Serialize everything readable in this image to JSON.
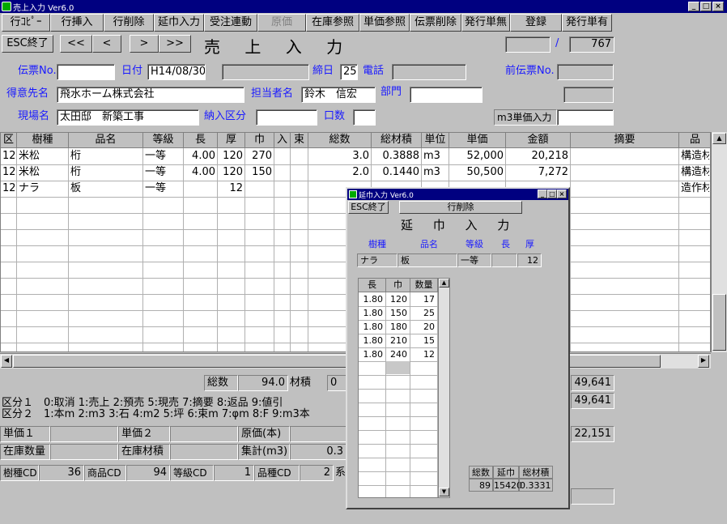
{
  "window": {
    "title": "売上入力 Ver6.0"
  },
  "toolbar": [
    {
      "label": "行ｺﾋﾟｰ",
      "disabled": false
    },
    {
      "label": "行挿入",
      "disabled": false
    },
    {
      "label": "行削除",
      "disabled": false
    },
    {
      "label": "延巾入力",
      "disabled": false
    },
    {
      "label": "受注連動",
      "disabled": false
    },
    {
      "label": "原価",
      "disabled": true
    },
    {
      "label": "在庫参照",
      "disabled": false
    },
    {
      "label": "単価参照",
      "disabled": false
    },
    {
      "label": "伝票削除",
      "disabled": false
    },
    {
      "label": "発行単無",
      "disabled": false
    },
    {
      "label": "登録",
      "disabled": false
    },
    {
      "label": "発行単有",
      "disabled": false
    }
  ],
  "nav": {
    "esc": "ESC終了",
    "first": "<<",
    "prev": "<",
    "next": ">",
    "last": ">>",
    "title": "売 上 入 力",
    "slash": "/",
    "total": "767",
    "current": ""
  },
  "form": {
    "denpyo_label": "伝票No.",
    "denpyo_value": "",
    "date_label": "日付",
    "date_value": "H14/08/30",
    "date_extra": "",
    "shime_label": "締日",
    "shime_value": "25",
    "tel_label": "電話",
    "tel_value": "",
    "prev_label": "前伝票No.",
    "prev_value": "",
    "customer_label": "得意先名",
    "customer_value": "飛水ホーム株式会社",
    "tanto_label": "担当者名",
    "tanto_value": "鈴木　信宏",
    "bumon_label": "部門",
    "bumon_value": "",
    "genba_label": "現場名",
    "genba_value": "太田邸　新築工事",
    "nonyu_label": "納入区分",
    "nonyu_value": "",
    "kuchi_label": "口数",
    "kuchi_value": "",
    "m3_label": "m3単価入力",
    "m3_value": ""
  },
  "table": {
    "columns": [
      "区",
      "樹種",
      "品名",
      "等級",
      "長",
      "厚",
      "巾",
      "入",
      "束",
      "総数",
      "総材積",
      "単位",
      "単価",
      "金額",
      "摘要",
      "品"
    ],
    "rows": [
      [
        "12",
        "米松",
        "桁",
        "一等",
        "4.00",
        "120",
        "270",
        "",
        "",
        "3.0",
        "0.3888",
        "m3",
        "52,000",
        "20,218",
        "",
        "構造材"
      ],
      [
        "12",
        "米松",
        "桁",
        "一等",
        "4.00",
        "120",
        "150",
        "",
        "",
        "2.0",
        "0.1440",
        "m3",
        "50,500",
        "7,272",
        "",
        "構造材"
      ],
      [
        "12",
        "ナラ",
        "板",
        "一等",
        "",
        "12",
        "",
        "",
        "",
        "",
        "",
        "",
        "",
        "",
        "",
        "造作材"
      ]
    ]
  },
  "bottom": {
    "sosu_label": "総数",
    "sosu_value": "94.0",
    "zaiseki_label": "材積",
    "zaiseki_value": "0",
    "amount1": "49,641",
    "amount2": "49,641",
    "amount3": "22,151",
    "kubun1": "区分１　0:取消 1:売上 2:預売 5:現売 7:摘要 8:返品 9:値引",
    "kubun2": "区分２　1:本m 2:m3 3:石 4:m2 5:坪 6:束m 7:φm 8:F 9:m3本",
    "tanka1_label": "単価１",
    "tanka1_value": "",
    "tanka2_label": "単価２",
    "tanka2_value": "",
    "genka_label": "原価(本)",
    "genka_value": "",
    "zaiko_label": "在庫数量",
    "zaiko_value": "",
    "zaikozai_label": "在庫材積",
    "zaikozai_value": "",
    "shukei_label": "集計(m3)",
    "shukei_value": "0.3",
    "jushu_label": "樹種CD",
    "jushu_value": "36",
    "shohin_label": "商品CD",
    "shohin_value": "94",
    "tokyu_label": "等級CD",
    "tokyu_value": "1",
    "hinshu_label": "品種CD",
    "hinshu_value": "2",
    "hinshu_tail": "系"
  },
  "dialog": {
    "title": "延巾入力 Ver6.0",
    "esc": "ESC終了",
    "delete": "行削除",
    "heading": "延 巾 入 力",
    "hdr_jushu": "樹種",
    "hdr_hinmei": "品名",
    "hdr_tokyu": "等級",
    "hdr_cho": "長",
    "hdr_atsu": "厚",
    "val_jushu": "ナラ",
    "val_hinmei": "板",
    "val_tokyu": "一等",
    "val_cho": "",
    "val_atsu": "12",
    "columns": [
      "長",
      "巾",
      "数量"
    ],
    "rows": [
      [
        "1.80",
        "120",
        "17"
      ],
      [
        "1.80",
        "150",
        "25"
      ],
      [
        "1.80",
        "180",
        "20"
      ],
      [
        "1.80",
        "210",
        "15"
      ],
      [
        "1.80",
        "240",
        "12"
      ]
    ],
    "sum_labels": [
      "総数",
      "延巾",
      "総材積"
    ],
    "sum_values": [
      "89",
      "15420",
      "0.3331"
    ]
  }
}
